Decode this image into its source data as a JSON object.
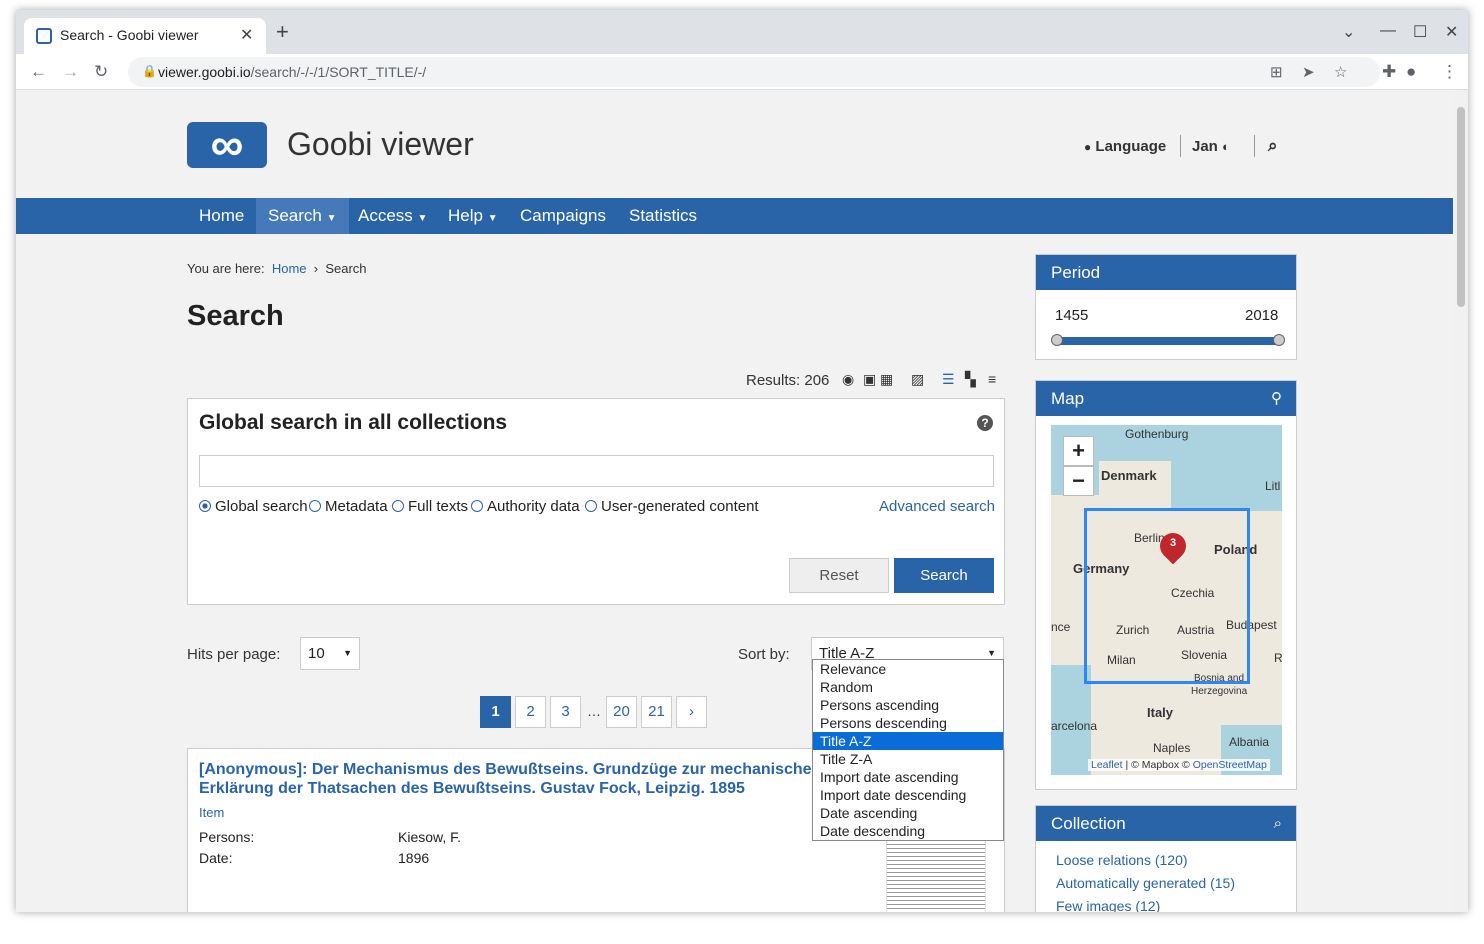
{
  "browser": {
    "tab_title": "Search - Goobi viewer",
    "url_host": "viewer.goobi.io",
    "url_path": "/search/-/-/1/SORT_TITLE/-/",
    "new_tab": "+",
    "tab_close": "✕"
  },
  "header": {
    "logo_glyph": "∞",
    "brand": "Goobi viewer",
    "language": "Language",
    "user": "Jan"
  },
  "nav": {
    "items": [
      "Home",
      "Search",
      "Access",
      "Help",
      "Campaigns",
      "Statistics"
    ]
  },
  "breadcrumb": {
    "prefix": "You are here:",
    "home": "Home",
    "sep": "›",
    "current": "Search"
  },
  "page_title": "Search",
  "results_label": "Results: 206",
  "search": {
    "title": "Global search in all collections",
    "help": "?",
    "input_value": "",
    "options": [
      "Global search",
      "Metadata",
      "Full texts",
      "Authority data",
      "User-generated content"
    ],
    "advanced": "Advanced search",
    "reset": "Reset",
    "submit": "Search"
  },
  "hits_per_page": {
    "label": "Hits per page:",
    "value": "10"
  },
  "sort": {
    "label": "Sort by:",
    "value": "Title A-Z",
    "options": [
      "Relevance",
      "Random",
      "Persons ascending",
      "Persons descending",
      "Title A-Z",
      "Title Z-A",
      "Import date ascending",
      "Import date descending",
      "Date ascending",
      "Date descending"
    ],
    "selected_index": 4
  },
  "pagination": {
    "pages": [
      "1",
      "2",
      "3",
      "20",
      "21",
      "›"
    ],
    "ellipsis": "…",
    "current": "1"
  },
  "hit": {
    "title": "[Anonymous]: Der Mechanismus des Bewußtseins. Grundzüge zur mechanische Erklärung der Thatsachen des Bewußtseins. Gustav Fock, Leipzig. 1895",
    "type": "Item",
    "persons_label": "Persons:",
    "persons_value": "Kiesow, F.",
    "date_label": "Date:",
    "date_value": "1896"
  },
  "sidebar": {
    "period": {
      "title": "Period",
      "from": "1455",
      "to": "2018"
    },
    "map": {
      "title": "Map",
      "zoom_in": "+",
      "zoom_out": "−",
      "marker_count": "3",
      "labels": [
        "Gothenburg",
        "Denmark",
        "Litl",
        "Berlin",
        "Poland",
        "Germany",
        "Czechia",
        "nce",
        "Zurich",
        "Austria",
        "Budapest",
        "Milan",
        "Slovenia",
        "R",
        "Bosnia and",
        "Herzegovina",
        "Italy",
        "arcelona",
        "Albania",
        "Naples"
      ],
      "attribution_leaflet": "Leaflet",
      "attribution_rest": "| © Mapbox ©",
      "attribution_osm": "OpenStreetMap"
    },
    "collection": {
      "title": "Collection",
      "items": [
        "Loose relations (120)",
        "Automatically generated (15)",
        "Few images (12)"
      ]
    }
  },
  "colors": {
    "primary": "#2a64a8",
    "dropdown_highlight": "#0a6cd6",
    "marker": "#c0272d"
  }
}
